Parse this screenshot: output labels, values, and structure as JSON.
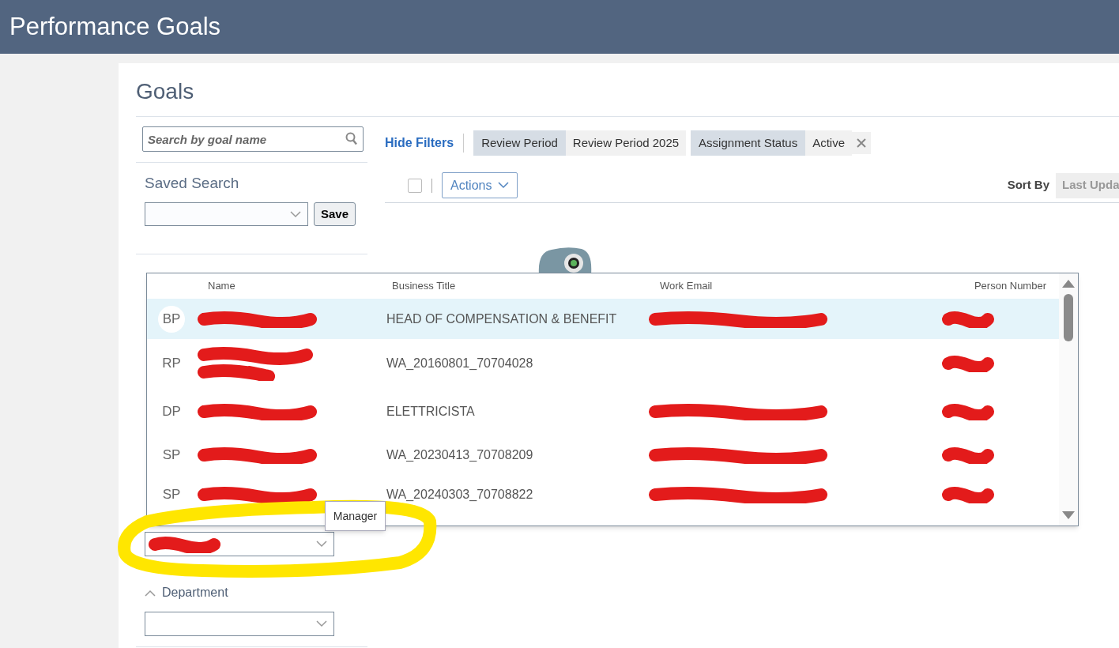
{
  "header": {
    "title": "Performance Goals"
  },
  "page": {
    "title": "Goals"
  },
  "search": {
    "placeholder": "Search by goal name"
  },
  "saved_search": {
    "label": "Saved Search",
    "button": "Save"
  },
  "toolbar": {
    "hide_filters": "Hide Filters",
    "select_all_checked": false,
    "actions": "Actions",
    "sort_label": "Sort By",
    "sort_value": "Last Upda",
    "chips": [
      {
        "name": "Review Period",
        "value": "Review Period 2025",
        "removable": false
      },
      {
        "name": "Assignment Status",
        "value": "Active",
        "removable": true
      }
    ]
  },
  "popup": {
    "columns": [
      "Name",
      "Business Title",
      "Work Email",
      "Person Number"
    ],
    "rows": [
      {
        "initials": "BP",
        "title": "HEAD OF COMPENSATION & BENEFIT",
        "email_redacted": true,
        "selected": true
      },
      {
        "initials": "RP",
        "title": "WA_20160801_70704028",
        "email_redacted": false,
        "selected": false
      },
      {
        "initials": "DP",
        "title": "ELETTRICISTA",
        "email_redacted": true,
        "selected": false
      },
      {
        "initials": "SP",
        "title": "WA_20230413_70708209",
        "email_redacted": true,
        "selected": false
      },
      {
        "initials": "SP",
        "title": "WA_20240303_70708822",
        "email_redacted": true,
        "selected": false
      }
    ]
  },
  "manager": {
    "tooltip": "Manager"
  },
  "department": {
    "label": "Department",
    "expanded": true
  }
}
